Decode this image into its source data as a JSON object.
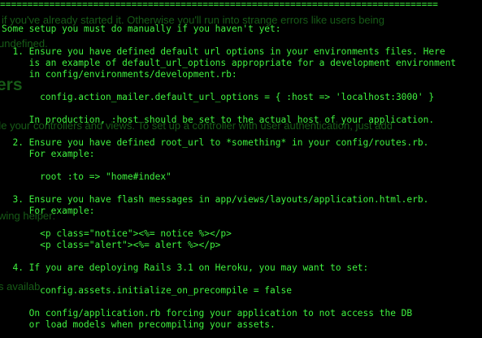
{
  "colors": {
    "background": "#000000",
    "terminal_text": "#3ff23f",
    "ghost_text": "#1f7a1f"
  },
  "ghost": {
    "line1": "if you've already started it. Otherwise you'll run into strange errors like users being",
    "line2": "undefined.",
    "heading": "ers",
    "line3": "de your controllers and views. To set up a controller with user authentication, just add",
    "line4": "wing helper:",
    "line5": "s availab"
  },
  "terminal": {
    "rule": "================================================================================",
    "intro": "Some setup you must do manually if you haven't yet:",
    "step1": {
      "line1": "  1. Ensure you have defined default url options in your environments files. Here",
      "line2": "     is an example of default_url_options appropriate for a development environment",
      "line3": "     in config/environments/development.rb:",
      "code": "       config.action_mailer.default_url_options = { :host => 'localhost:3000' }",
      "note": "     In production, :host should be set to the actual host of your application."
    },
    "step2": {
      "line1": "  2. Ensure you have defined root_url to *something* in your config/routes.rb.",
      "line2": "     For example:",
      "code": "       root :to => \"home#index\""
    },
    "step3": {
      "line1": "  3. Ensure you have flash messages in app/views/layouts/application.html.erb.",
      "line2": "     For example:",
      "code1": "       <p class=\"notice\"><%= notice %></p>",
      "code2": "       <p class=\"alert\"><%= alert %></p>"
    },
    "step4": {
      "line1": "  4. If you are deploying Rails 3.1 on Heroku, you may want to set:",
      "code": "       config.assets.initialize_on_precompile = false",
      "note1": "     On config/application.rb forcing your application to not access the DB",
      "note2": "     or load models when precompiling your assets."
    }
  }
}
